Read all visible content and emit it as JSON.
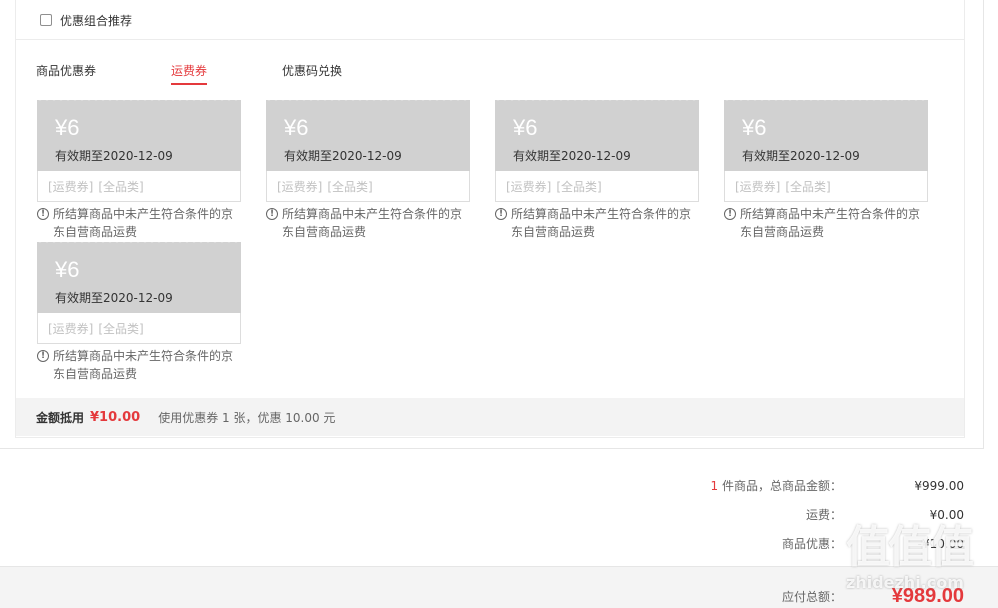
{
  "combo": {
    "label": "优惠组合推荐"
  },
  "tabs": [
    {
      "label": "商品优惠券",
      "active": false
    },
    {
      "label": "运费券",
      "active": true
    },
    {
      "label": "优惠码兑换",
      "active": false
    }
  ],
  "coupons": [
    {
      "amount": "¥6",
      "validity": "有效期至2020-12-09",
      "tags": [
        "[运费券]",
        "[全品类]"
      ],
      "note": "所结算商品中未产生符合条件的京东自营商品运费"
    },
    {
      "amount": "¥6",
      "validity": "有效期至2020-12-09",
      "tags": [
        "[运费券]",
        "[全品类]"
      ],
      "note": "所结算商品中未产生符合条件的京东自营商品运费"
    },
    {
      "amount": "¥6",
      "validity": "有效期至2020-12-09",
      "tags": [
        "[运费券]",
        "[全品类]"
      ],
      "note": "所结算商品中未产生符合条件的京东自营商品运费"
    },
    {
      "amount": "¥6",
      "validity": "有效期至2020-12-09",
      "tags": [
        "[运费券]",
        "[全品类]"
      ],
      "note": "所结算商品中未产生符合条件的京东自营商品运费"
    },
    {
      "amount": "¥6",
      "validity": "有效期至2020-12-09",
      "tags": [
        "[运费券]",
        "[全品类]"
      ],
      "note": "所结算商品中未产生符合条件的京东自营商品运费"
    }
  ],
  "summary": {
    "label": "金额抵用",
    "amount": "¥10.00",
    "desc": "使用优惠券 1 张，优惠 10.00 元"
  },
  "totals": {
    "count": "1",
    "goods_label": "件商品，总商品金额：",
    "goods_value": "¥999.00",
    "shipping_label": "运费：",
    "shipping_value": "¥0.00",
    "discount_label": "商品优惠：",
    "discount_value": "-¥10.00",
    "payable_label": "应付总额：",
    "payable_value": "¥989.00"
  },
  "watermark": {
    "logo": "值值值",
    "text": "zhidezhi.com"
  },
  "colors": {
    "accent": "#e4393c",
    "coupon_gray": "#d1d1d1"
  }
}
